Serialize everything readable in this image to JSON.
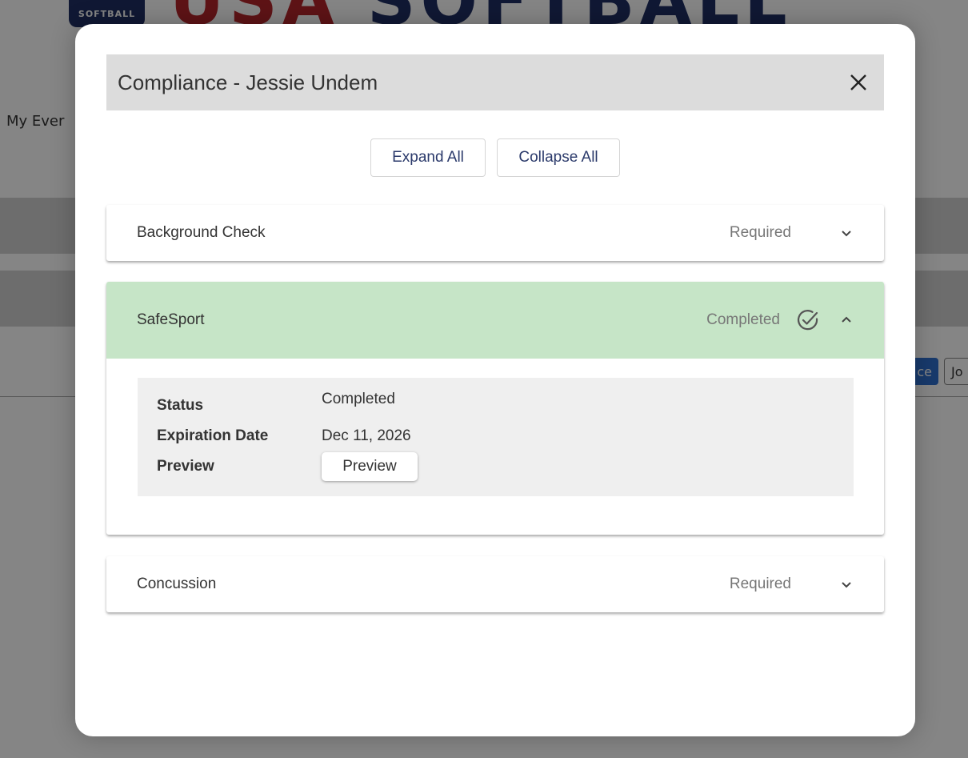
{
  "background": {
    "logo_badge_text": "SOFTBALL",
    "banner_text_red": "USA",
    "banner_text_blue": "SOFTBALL",
    "nav_label": "My Ever",
    "button_blue_text": "ce",
    "button_outline_text": "Jo"
  },
  "modal": {
    "title": "Compliance - Jessie Undem",
    "close_icon": "close-icon",
    "expand_all_label": "Expand All",
    "collapse_all_label": "Collapse All"
  },
  "items": [
    {
      "name": "Background Check",
      "status": "Required",
      "expanded": false
    },
    {
      "name": "SafeSport",
      "status": "Completed",
      "expanded": true,
      "details": {
        "status_label": "Status",
        "status_value": "Completed",
        "expiration_label": "Expiration Date",
        "expiration_value": "Dec 11, 2026",
        "preview_label": "Preview",
        "preview_button": "Preview"
      }
    },
    {
      "name": "Concussion",
      "status": "Required",
      "expanded": false
    }
  ],
  "colors": {
    "completed_bg": "#c6e5c7",
    "button_text": "#2b3a6b",
    "header_bg": "#dcdcdc"
  }
}
